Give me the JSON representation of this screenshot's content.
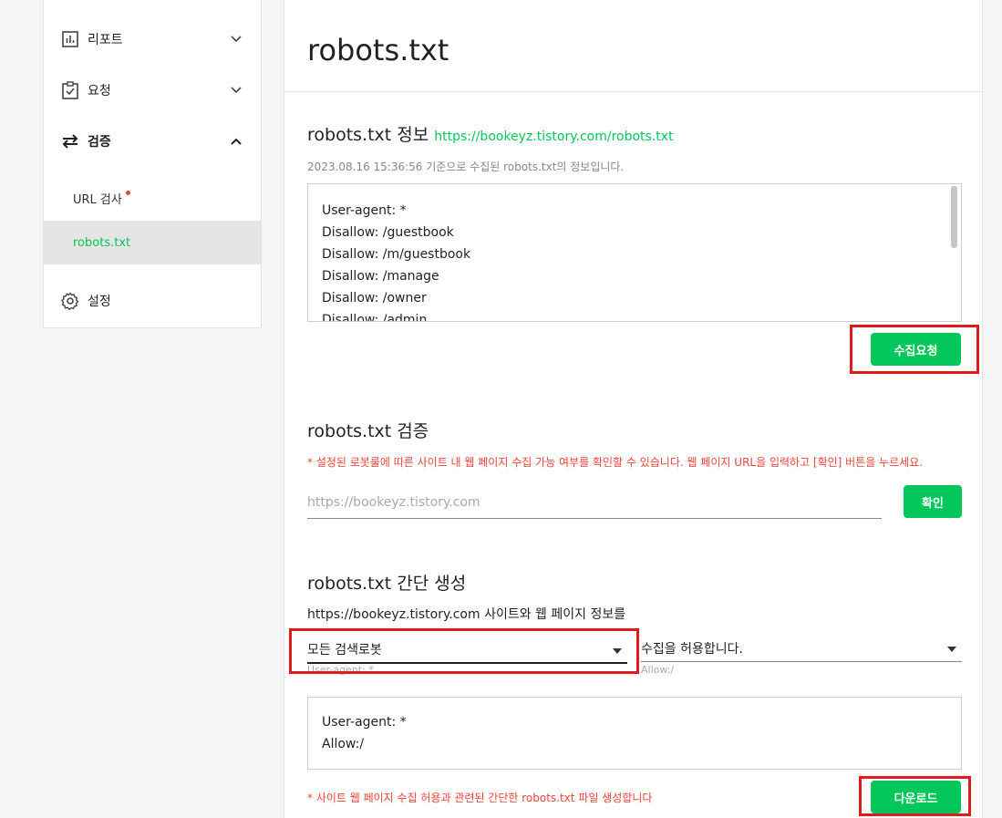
{
  "sidebar": {
    "items": [
      {
        "label": "리포트",
        "icon": "chart-icon"
      },
      {
        "label": "요청",
        "icon": "clipboard-check-icon"
      },
      {
        "label": "검증",
        "icon": "transfer-arrows-icon"
      }
    ],
    "sub_items": [
      {
        "label": "URL 검사",
        "has_dot": true
      },
      {
        "label": "robots.txt",
        "active": true
      }
    ],
    "settings": {
      "label": "설정",
      "icon": "gear-icon"
    }
  },
  "main": {
    "title": "robots.txt",
    "info": {
      "title": "robots.txt 정보",
      "url": "https://bookeyz.tistory.com/robots.txt",
      "desc": "2023.08.16 15:36:56 기준으로 수집된 robots.txt의 정보입니다.",
      "lines": [
        "User-agent: *",
        "Disallow: /guestbook",
        "Disallow: /m/guestbook",
        "Disallow: /manage",
        "Disallow: /owner",
        "Disallow: /admin"
      ],
      "button": "수집요청"
    },
    "verify": {
      "title": "robots.txt 검증",
      "warning": "* 설정된 로봇룰에 따른 사이트 내 웹 페이지 수집 가능 여부를 확인할 수 있습니다. 웹 페이지 URL을 입력하고 [확인] 버튼을 누르세요.",
      "placeholder": "https://bookeyz.tistory.com",
      "button": "확인"
    },
    "generate": {
      "title": "robots.txt 간단 생성",
      "intro": "https://bookeyz.tistory.com 사이트와 웹 페이지 정보를",
      "robot_select": "모든 검색로봇",
      "robot_helper": "User-agent: *",
      "permission_select": "수집을 허용합니다.",
      "permission_helper": "Allow:/",
      "lines": [
        "User-agent: *",
        "Allow:/"
      ],
      "note": "* 사이트 웹 페이지 수집 허용과 관련된 간단한 robots.txt 파일 생성합니다",
      "button": "다운로드"
    }
  },
  "colors": {
    "accent": "#03c75a",
    "warning": "#f0443a",
    "highlight": "#e01b1b"
  }
}
